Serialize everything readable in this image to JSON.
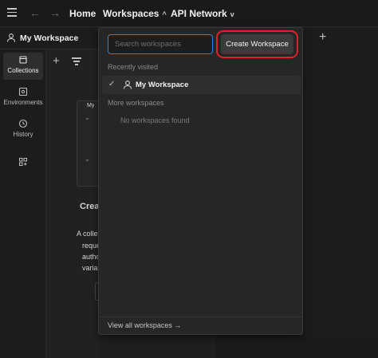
{
  "topbar": {
    "back_arrow": "←",
    "forward_arrow": "→",
    "home": "Home",
    "workspaces": "Workspaces",
    "workspaces_chevron": "^",
    "api_network": "API Network",
    "api_network_chevron": "v"
  },
  "workspace_header": {
    "name": "My Workspace"
  },
  "sidebar": {
    "items": [
      {
        "label": "Collections",
        "icon": "collections-icon",
        "active": true
      },
      {
        "label": "Environments",
        "icon": "environments-icon"
      },
      {
        "label": "History",
        "icon": "history-icon"
      },
      {
        "label": "",
        "icon": "apps-grid-icon"
      }
    ]
  },
  "panel": {
    "add": "+",
    "card_title_fragment": "My",
    "heading_fragment": "Crea",
    "desc_fragments": [
      "A colle",
      "reque",
      "autho",
      "varia"
    ]
  },
  "tabs": {
    "new_tab": "+"
  },
  "dropdown": {
    "search_placeholder": "Search workspaces",
    "create_label": "Create Workspace",
    "recently_visited_label": "Recently visited",
    "recent_items": [
      {
        "name": "My Workspace",
        "selected": true,
        "check": "✓"
      }
    ],
    "more_label": "More workspaces",
    "empty_label": "No workspaces found",
    "view_all_label": "View all workspaces →"
  },
  "colors": {
    "accent_focus": "#2f86d9",
    "annotation_red": "#e0202a",
    "background": "#212121"
  }
}
